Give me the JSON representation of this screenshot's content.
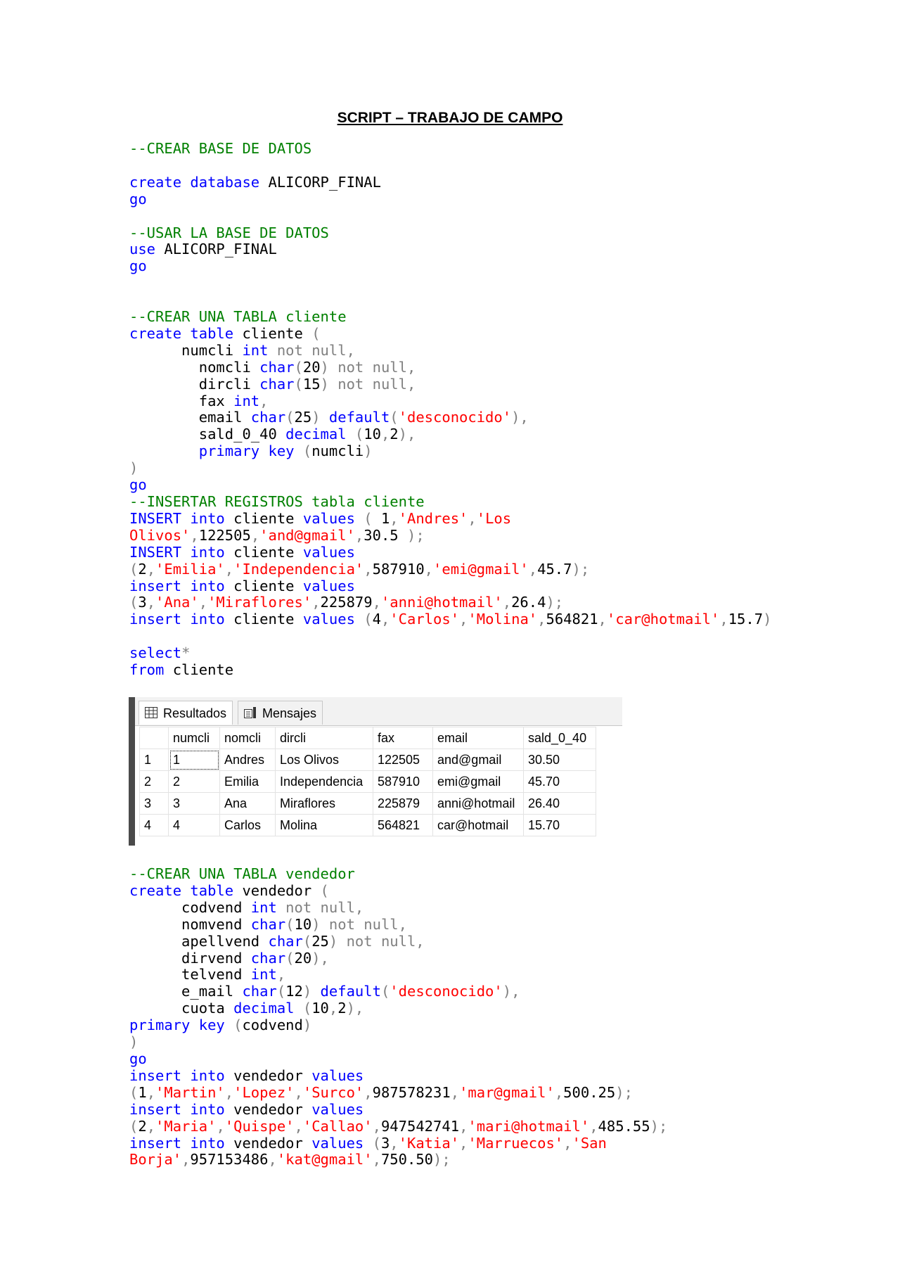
{
  "title": "SCRIPT – TRABAJO DE CAMPO",
  "code_block_1": [
    [
      [
        "--CREAR BASE DE DATOS",
        "c"
      ]
    ],
    [],
    [
      [
        "create database ",
        "k"
      ],
      [
        "ALICORP_FINAL",
        ""
      ]
    ],
    [
      [
        "go",
        "k"
      ]
    ],
    [],
    [
      [
        "--USAR LA BASE DE DATOS",
        "c"
      ]
    ],
    [
      [
        "use ",
        "k"
      ],
      [
        "ALICORP_FINAL",
        ""
      ]
    ],
    [
      [
        "go",
        "k"
      ]
    ],
    [],
    [],
    [
      [
        "--CREAR UNA TABLA cliente",
        "c"
      ]
    ],
    [
      [
        "create table ",
        "k"
      ],
      [
        "cliente ",
        ""
      ],
      [
        "(",
        "p"
      ]
    ],
    [
      [
        "      numcli ",
        ""
      ],
      [
        "int ",
        "k"
      ],
      [
        "not null,",
        "g"
      ]
    ],
    [
      [
        "        nomcli ",
        ""
      ],
      [
        "char",
        "k"
      ],
      [
        "(",
        "p"
      ],
      [
        "20",
        ""
      ],
      [
        ") not null,",
        "g"
      ]
    ],
    [
      [
        "        dircli ",
        ""
      ],
      [
        "char",
        "k"
      ],
      [
        "(",
        "p"
      ],
      [
        "15",
        ""
      ],
      [
        ") not null,",
        "g"
      ]
    ],
    [
      [
        "        fax ",
        ""
      ],
      [
        "int",
        "k"
      ],
      [
        ",",
        "p"
      ]
    ],
    [
      [
        "        email ",
        ""
      ],
      [
        "char",
        "k"
      ],
      [
        "(",
        "p"
      ],
      [
        "25",
        ""
      ],
      [
        ") ",
        "p"
      ],
      [
        "default",
        "k"
      ],
      [
        "(",
        "p"
      ],
      [
        "'desconocido'",
        "s"
      ],
      [
        "),",
        "p"
      ]
    ],
    [
      [
        "        sald_0_40 ",
        ""
      ],
      [
        "decimal ",
        "k"
      ],
      [
        "(",
        "p"
      ],
      [
        "10",
        ""
      ],
      [
        ",",
        "p"
      ],
      [
        "2",
        ""
      ],
      [
        "),",
        "p"
      ]
    ],
    [
      [
        "        ",
        ""
      ],
      [
        "primary key ",
        "k"
      ],
      [
        "(",
        "p"
      ],
      [
        "numcli",
        ""
      ],
      [
        ")",
        "p"
      ]
    ],
    [
      [
        ")",
        "p"
      ]
    ],
    [
      [
        "go",
        "k"
      ]
    ],
    [
      [
        "--INSERTAR REGISTROS tabla cliente",
        "c"
      ]
    ],
    [
      [
        "INSERT into ",
        "k"
      ],
      [
        "cliente ",
        ""
      ],
      [
        "values ",
        "k"
      ],
      [
        "( ",
        "p"
      ],
      [
        "1",
        ""
      ],
      [
        ",",
        "p"
      ],
      [
        "'Andres'",
        "s"
      ],
      [
        ",",
        "p"
      ],
      [
        "'Los",
        "s"
      ]
    ],
    [
      [
        "Olivos'",
        "s"
      ],
      [
        ",",
        "p"
      ],
      [
        "122505",
        ""
      ],
      [
        ",",
        "p"
      ],
      [
        "'and@gmail'",
        "s"
      ],
      [
        ",",
        "p"
      ],
      [
        "30.5 ",
        ""
      ],
      [
        ");",
        "p"
      ]
    ],
    [
      [
        "INSERT into ",
        "k"
      ],
      [
        "cliente ",
        ""
      ],
      [
        "values",
        "k"
      ]
    ],
    [
      [
        "(",
        "p"
      ],
      [
        "2",
        ""
      ],
      [
        ",",
        "p"
      ],
      [
        "'Emilia'",
        "s"
      ],
      [
        ",",
        "p"
      ],
      [
        "'Independencia'",
        "s"
      ],
      [
        ",",
        "p"
      ],
      [
        "587910",
        ""
      ],
      [
        ",",
        "p"
      ],
      [
        "'emi@gmail'",
        "s"
      ],
      [
        ",",
        "p"
      ],
      [
        "45.7",
        ""
      ],
      [
        ");",
        "p"
      ]
    ],
    [
      [
        "insert into ",
        "k"
      ],
      [
        "cliente ",
        ""
      ],
      [
        "values",
        "k"
      ]
    ],
    [
      [
        "(",
        "p"
      ],
      [
        "3",
        ""
      ],
      [
        ",",
        "p"
      ],
      [
        "'Ana'",
        "s"
      ],
      [
        ",",
        "p"
      ],
      [
        "'Miraflores'",
        "s"
      ],
      [
        ",",
        "p"
      ],
      [
        "225879",
        ""
      ],
      [
        ",",
        "p"
      ],
      [
        "'anni@hotmail'",
        "s"
      ],
      [
        ",",
        "p"
      ],
      [
        "26.4",
        ""
      ],
      [
        ");",
        "p"
      ]
    ],
    [
      [
        "insert into ",
        "k"
      ],
      [
        "cliente ",
        ""
      ],
      [
        "values ",
        "k"
      ],
      [
        "(",
        "p"
      ],
      [
        "4",
        ""
      ],
      [
        ",",
        "p"
      ],
      [
        "'Carlos'",
        "s"
      ],
      [
        ",",
        "p"
      ],
      [
        "'Molina'",
        "s"
      ],
      [
        ",",
        "p"
      ],
      [
        "564821",
        ""
      ],
      [
        ",",
        "p"
      ],
      [
        "'car@hotmail'",
        "s"
      ],
      [
        ",",
        "p"
      ],
      [
        "15.7",
        ""
      ],
      [
        ")",
        "p"
      ]
    ],
    [],
    [
      [
        "select",
        "k"
      ],
      [
        "*",
        "g"
      ]
    ],
    [
      [
        "from ",
        "k"
      ],
      [
        "cliente",
        ""
      ]
    ]
  ],
  "results": {
    "tab_results": "Resultados",
    "tab_messages": "Mensajes",
    "columns": [
      "numcli",
      "nomcli",
      "dircli",
      "fax",
      "email",
      "sald_0_40"
    ],
    "rows": [
      [
        "1",
        "1",
        "Andres",
        "Los Olivos",
        "122505",
        "and@gmail",
        "30.50"
      ],
      [
        "2",
        "2",
        "Emilia",
        "Independencia",
        "587910",
        "emi@gmail",
        "45.70"
      ],
      [
        "3",
        "3",
        "Ana",
        "Miraflores",
        "225879",
        "anni@hotmail",
        "26.40"
      ],
      [
        "4",
        "4",
        "Carlos",
        "Molina",
        "564821",
        "car@hotmail",
        "15.70"
      ]
    ]
  },
  "code_block_2": [
    [
      [
        "--CREAR UNA TABLA vendedor",
        "c"
      ]
    ],
    [
      [
        "create table ",
        "k"
      ],
      [
        "vendedor ",
        ""
      ],
      [
        "(",
        "p"
      ]
    ],
    [
      [
        "      codvend ",
        ""
      ],
      [
        "int ",
        "k"
      ],
      [
        "not null,",
        "g"
      ]
    ],
    [
      [
        "      nomvend ",
        ""
      ],
      [
        "char",
        "k"
      ],
      [
        "(",
        "p"
      ],
      [
        "10",
        ""
      ],
      [
        ") not null,",
        "g"
      ]
    ],
    [
      [
        "      apellvend ",
        ""
      ],
      [
        "char",
        "k"
      ],
      [
        "(",
        "p"
      ],
      [
        "25",
        ""
      ],
      [
        ") not null,",
        "g"
      ]
    ],
    [
      [
        "      dirvend ",
        ""
      ],
      [
        "char",
        "k"
      ],
      [
        "(",
        "p"
      ],
      [
        "20",
        ""
      ],
      [
        "),",
        "p"
      ]
    ],
    [
      [
        "      telvend ",
        ""
      ],
      [
        "int",
        "k"
      ],
      [
        ",",
        "p"
      ]
    ],
    [
      [
        "      e_mail ",
        ""
      ],
      [
        "char",
        "k"
      ],
      [
        "(",
        "p"
      ],
      [
        "12",
        ""
      ],
      [
        ") ",
        "p"
      ],
      [
        "default",
        "k"
      ],
      [
        "(",
        "p"
      ],
      [
        "'desconocido'",
        "s"
      ],
      [
        "),",
        "p"
      ]
    ],
    [
      [
        "      cuota ",
        ""
      ],
      [
        "decimal ",
        "k"
      ],
      [
        "(",
        "p"
      ],
      [
        "10",
        ""
      ],
      [
        ",",
        "p"
      ],
      [
        "2",
        ""
      ],
      [
        "),",
        "p"
      ]
    ],
    [
      [
        "primary key ",
        "k"
      ],
      [
        "(",
        "p"
      ],
      [
        "codvend",
        ""
      ],
      [
        ")",
        "p"
      ]
    ],
    [
      [
        ")",
        "p"
      ]
    ],
    [
      [
        "go",
        "k"
      ]
    ],
    [
      [
        "insert into ",
        "k"
      ],
      [
        "vendedor ",
        ""
      ],
      [
        "values",
        "k"
      ]
    ],
    [
      [
        "(",
        "p"
      ],
      [
        "1",
        ""
      ],
      [
        ",",
        "p"
      ],
      [
        "'Martin'",
        "s"
      ],
      [
        ",",
        "p"
      ],
      [
        "'Lopez'",
        "s"
      ],
      [
        ",",
        "p"
      ],
      [
        "'Surco'",
        "s"
      ],
      [
        ",",
        "p"
      ],
      [
        "987578231",
        ""
      ],
      [
        ",",
        "p"
      ],
      [
        "'mar@gmail'",
        "s"
      ],
      [
        ",",
        "p"
      ],
      [
        "500.25",
        ""
      ],
      [
        ");",
        "p"
      ]
    ],
    [
      [
        "insert into ",
        "k"
      ],
      [
        "vendedor ",
        ""
      ],
      [
        "values",
        "k"
      ]
    ],
    [
      [
        "(",
        "p"
      ],
      [
        "2",
        ""
      ],
      [
        ",",
        "p"
      ],
      [
        "'Maria'",
        "s"
      ],
      [
        ",",
        "p"
      ],
      [
        "'Quispe'",
        "s"
      ],
      [
        ",",
        "p"
      ],
      [
        "'Callao'",
        "s"
      ],
      [
        ",",
        "p"
      ],
      [
        "947542741",
        ""
      ],
      [
        ",",
        "p"
      ],
      [
        "'mari@hotmail'",
        "s"
      ],
      [
        ",",
        "p"
      ],
      [
        "485.55",
        ""
      ],
      [
        ");",
        "p"
      ]
    ],
    [
      [
        "insert into ",
        "k"
      ],
      [
        "vendedor ",
        ""
      ],
      [
        "values ",
        "k"
      ],
      [
        "(",
        "p"
      ],
      [
        "3",
        ""
      ],
      [
        ",",
        "p"
      ],
      [
        "'Katia'",
        "s"
      ],
      [
        ",",
        "p"
      ],
      [
        "'Marruecos'",
        "s"
      ],
      [
        ",",
        "p"
      ],
      [
        "'San",
        "s"
      ]
    ],
    [
      [
        "Borja'",
        "s"
      ],
      [
        ",",
        "p"
      ],
      [
        "957153486",
        ""
      ],
      [
        ",",
        "p"
      ],
      [
        "'kat@gmail'",
        "s"
      ],
      [
        ",",
        "p"
      ],
      [
        "750.50",
        ""
      ],
      [
        ");",
        "p"
      ]
    ]
  ]
}
